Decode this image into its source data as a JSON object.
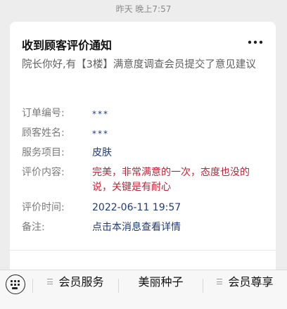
{
  "timestamp": "昨天 晚上7:57",
  "card": {
    "title": "收到顾客评价通知",
    "intro": "院长你好,有【3楼】满意度调查会员提交了意见建议",
    "fields": [
      {
        "label": "订单编号:",
        "value": "***"
      },
      {
        "label": "顾客姓名:",
        "value": "***"
      },
      {
        "label": "服务项目:",
        "value": "皮肤"
      },
      {
        "label": "评价内容:",
        "value": "完美，非常满意的一次，态度也没的说，关键是有耐心"
      },
      {
        "label": "评价时间:",
        "value": "2022-06-11 19:57"
      },
      {
        "label": "备注:",
        "value": "点击本消息查看详情"
      }
    ]
  },
  "menu": {
    "items": [
      {
        "label": "会员服务"
      },
      {
        "label": "美丽种子"
      },
      {
        "label": "会员尊享"
      }
    ]
  },
  "colors": {
    "value_blue": "#1f3b79",
    "value_red": "#c62034",
    "background": "#ededed"
  },
  "icons": {
    "more": "more-dots-icon",
    "keyboard": "keyboard-icon",
    "submenu": "hamburger-icon"
  }
}
